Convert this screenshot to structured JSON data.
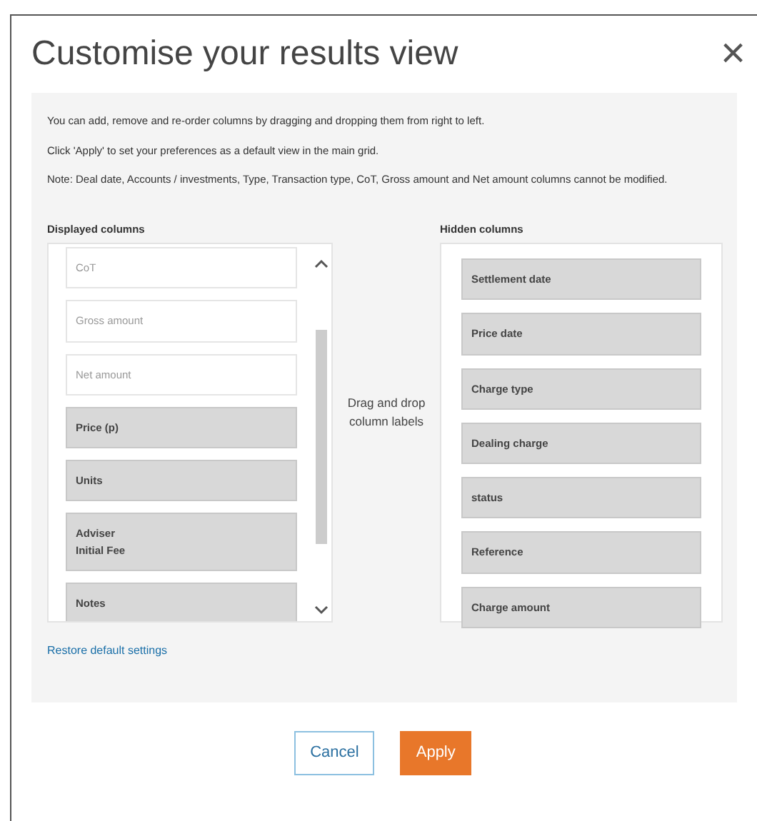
{
  "dialog": {
    "title": "Customise your results view",
    "close": "×"
  },
  "instructions": [
    "You can add, remove and re-order columns by dragging and dropping them from right to left.",
    "Click 'Apply' to set your preferences as a default view in the main grid.",
    "Note: Deal date, Accounts / investments, Type, Transaction type, CoT, Gross amount and Net amount columns cannot be modified."
  ],
  "displayed_columns": {
    "heading": "Displayed columns",
    "items": [
      {
        "label": "CoT",
        "kind": "fixed"
      },
      {
        "label": "Gross amount",
        "kind": "fixed"
      },
      {
        "label": "Net amount",
        "kind": "fixed"
      },
      {
        "label": "Price (p)",
        "kind": "movable"
      },
      {
        "label": "Units",
        "kind": "movable"
      },
      {
        "label": "Adviser\nInitial Fee",
        "kind": "movable"
      },
      {
        "label": "Notes",
        "kind": "movable"
      }
    ]
  },
  "hint": "Drag and drop column labels",
  "hidden_columns": {
    "heading": "Hidden columns",
    "items": [
      {
        "label": "Settlement date",
        "kind": "movable"
      },
      {
        "label": "Price date",
        "kind": "movable"
      },
      {
        "label": "Charge type",
        "kind": "movable"
      },
      {
        "label": "Dealing charge",
        "kind": "movable"
      },
      {
        "label": "status",
        "kind": "movable"
      },
      {
        "label": "Reference",
        "kind": "movable"
      },
      {
        "label": "Charge amount",
        "kind": "movable"
      }
    ]
  },
  "restore_link": "Restore default settings",
  "buttons": [
    {
      "label": "Cancel",
      "kind": "secondary"
    },
    {
      "label": "Apply",
      "kind": "primary"
    }
  ]
}
